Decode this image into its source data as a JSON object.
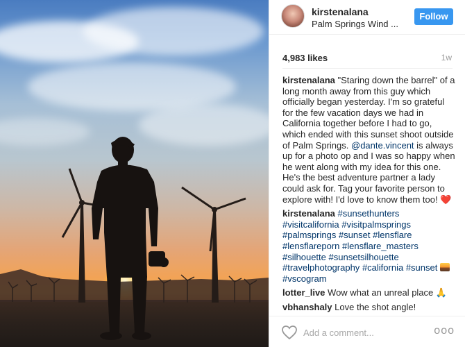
{
  "post": {
    "image_alt": "Silhouette of man holding camera among wind turbines at sunset"
  },
  "header": {
    "username": "kirstenalana",
    "location": "Palm Springs Wind ...",
    "follow_label": "Follow"
  },
  "stats": {
    "likes": "4,983 likes",
    "age": "1w"
  },
  "caption": {
    "username": "kirstenalana",
    "text_1": "\"Staring down the barrel\" of a long month away from this guy which officially began yesterday. I'm so grateful for the few vacation days we had in California together before I had to go, which ended with this sunset shoot outside of Palm Springs. ",
    "mention": "@dante.vincent",
    "text_2": " is always up for a photo op and I was so happy when he went along with my idea for this one. He's the best adventure partner a lady could ask for. Tag your favorite person to explore with! I'd love to know them too! ",
    "heart_emoji": "❤️"
  },
  "hashtags_comment": {
    "username": "kirstenalana",
    "tags": [
      "#sunsethunters",
      "#visitcalifornia",
      "#visitpalmsprings",
      "#palmsprings",
      "#sunset",
      "#lensflare",
      "#lensflareporn",
      "#lensflare_masters",
      "#silhouette",
      "#sunsetsilhouette",
      "#travelphotography",
      "#california",
      "#sunset"
    ],
    "last_tag": "#vscogram"
  },
  "comments": [
    {
      "username": "lotter_live",
      "text": "Wow what an unreal place",
      "emoji": "🙏"
    },
    {
      "username": "vbhanshaly",
      "text": "Love the shot angle!"
    }
  ],
  "footer": {
    "add_comment_placeholder": "Add a comment...",
    "more_label": "ooo"
  },
  "colors": {
    "follow_button": "#3897f0",
    "link": "#003569",
    "heart": "#e0242a"
  }
}
